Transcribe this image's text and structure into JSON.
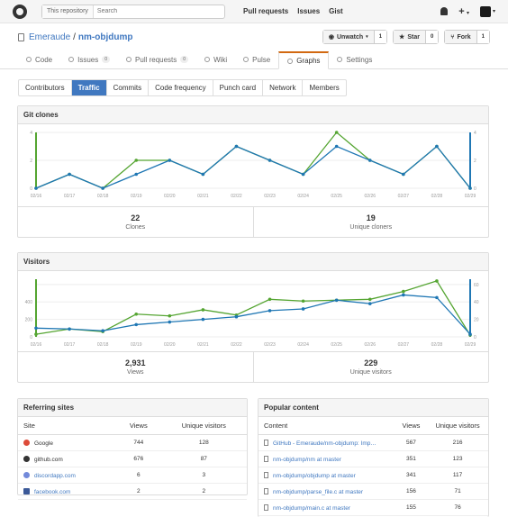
{
  "header": {
    "search_scope": "This repository",
    "search_placeholder": "Search",
    "nav": [
      "Pull requests",
      "Issues",
      "Gist"
    ],
    "plus": "+"
  },
  "repo": {
    "owner": "Emeraude",
    "name": "nm-objdump",
    "separator": "/",
    "unwatch_label": "Unwatch",
    "unwatch_count": "1",
    "star_label": "Star",
    "star_count": "0",
    "fork_label": "Fork",
    "fork_count": "1"
  },
  "tabs": [
    {
      "label": "Code",
      "icon": "code-icon"
    },
    {
      "label": "Issues",
      "count": "0",
      "icon": "issue-icon"
    },
    {
      "label": "Pull requests",
      "count": "0",
      "icon": "pull-request-icon"
    },
    {
      "label": "Wiki",
      "icon": "book-icon"
    },
    {
      "label": "Pulse",
      "icon": "pulse-icon"
    },
    {
      "label": "Graphs",
      "icon": "graph-icon",
      "active": true
    },
    {
      "label": "Settings",
      "icon": "gear-icon"
    }
  ],
  "subnav": [
    "Contributors",
    "Traffic",
    "Commits",
    "Code frequency",
    "Punch card",
    "Network",
    "Members"
  ],
  "colors": {
    "green": "#55a532",
    "blue": "#1f77b4",
    "grid": "#eeeeee"
  },
  "clones": {
    "title": "Git clones",
    "dates": [
      "02/16",
      "02/17",
      "02/18",
      "02/19",
      "02/20",
      "02/21",
      "02/22",
      "02/23",
      "02/24",
      "02/25",
      "02/26",
      "02/27",
      "02/28",
      "02/29"
    ],
    "total": [
      0,
      1,
      0,
      2,
      2,
      1,
      3,
      2,
      1,
      4,
      2,
      1,
      3,
      0
    ],
    "unique": [
      0,
      1,
      0,
      1,
      2,
      1,
      3,
      2,
      1,
      3,
      2,
      1,
      3,
      0
    ],
    "left_ticks": [
      "4",
      "2",
      "0"
    ],
    "right_ticks": [
      "4",
      "2",
      "0"
    ],
    "ymax": 4,
    "count": "22",
    "count_label": "Clones",
    "unique_count": "19",
    "unique_label": "Unique cloners"
  },
  "visitors": {
    "title": "Visitors",
    "dates": [
      "02/16",
      "02/17",
      "02/18",
      "02/19",
      "02/20",
      "02/21",
      "02/22",
      "02/23",
      "02/24",
      "02/25",
      "02/26",
      "02/27",
      "02/28",
      "02/29"
    ],
    "views": [
      30,
      90,
      60,
      260,
      240,
      310,
      250,
      430,
      410,
      420,
      430,
      520,
      640,
      20
    ],
    "unique": [
      10,
      9,
      7,
      14,
      17,
      20,
      23,
      30,
      32,
      42,
      38,
      48,
      45,
      3
    ],
    "left_ticks": [
      "400",
      "200",
      "0"
    ],
    "right_ticks": [
      "60",
      "40",
      "20",
      "0"
    ],
    "views_max": 660,
    "unique_max": 66,
    "count": "2,931",
    "count_label": "Views",
    "unique_count": "229",
    "unique_label": "Unique visitors"
  },
  "referrers": {
    "title": "Referring sites",
    "headers": [
      "Site",
      "Views",
      "Unique visitors"
    ],
    "rows": [
      {
        "site": "Google",
        "views": "744",
        "unique": "128",
        "icon": "google-icon",
        "color": "#dd4b39"
      },
      {
        "site": "github.com",
        "views": "676",
        "unique": "87",
        "icon": "github-icon",
        "color": "#333333"
      },
      {
        "site": "discordapp.com",
        "views": "6",
        "unique": "3",
        "icon": "discord-icon",
        "color": "#7289da"
      },
      {
        "site": "facebook.com",
        "views": "2",
        "unique": "2",
        "icon": "facebook-icon",
        "color": "#3b5998"
      }
    ]
  },
  "popular": {
    "title": "Popular content",
    "headers": [
      "Content",
      "Views",
      "Unique visitors"
    ],
    "rows": [
      {
        "content": "GitHub - Emeraude/nm-objdump: Imp…",
        "views": "567",
        "unique": "216"
      },
      {
        "content": "nm-objdump/nm at master",
        "views": "351",
        "unique": "123"
      },
      {
        "content": "nm-objdump/objdump at master",
        "views": "341",
        "unique": "117"
      },
      {
        "content": "nm-objdump/parse_file.c at master",
        "views": "156",
        "unique": "71"
      },
      {
        "content": "nm-objdump/main.c at master",
        "views": "155",
        "unique": "76"
      }
    ]
  }
}
